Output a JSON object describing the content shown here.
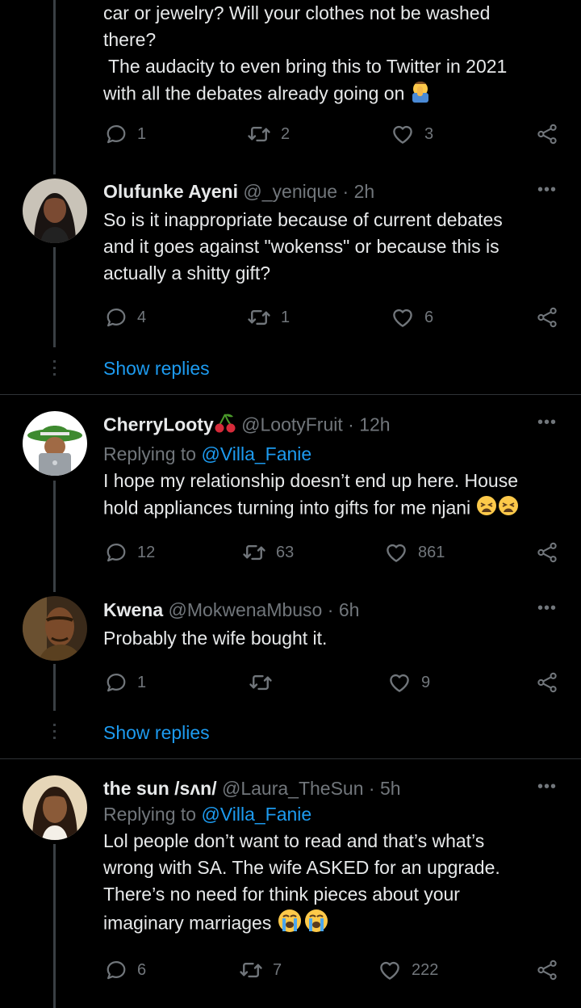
{
  "colors": {
    "background": "#000000",
    "link": "#1d9bf0",
    "muted": "#71767b",
    "text": "#e7e9ea"
  },
  "icons": {
    "reply": "speech-bubble-icon",
    "retweet": "retweet-arrows-icon",
    "like": "heart-icon",
    "share": "share-nodes-icon",
    "more": "ellipsis-icon"
  },
  "tweet0": {
    "lines": [
      "car or jewelry? Will your clothes not be washed",
      "there?",
      " The audacity to even bring this to Twitter in 2021",
      "with all the debates already going on"
    ],
    "emoji": "facepalm-emoji",
    "replies": "1",
    "retweets": "2",
    "likes": "3"
  },
  "tweet1": {
    "name": "Olufunke Ayeni",
    "handle": "@_yenique",
    "time": "2h",
    "dot": "·",
    "lines": [
      "So is it inappropriate because of current debates",
      "and it goes against \"wokenss\" or because this is",
      "actually a shitty gift?"
    ],
    "replies": "4",
    "retweets": "1",
    "likes": "6",
    "show_replies": "Show replies"
  },
  "tweet2": {
    "name": "CherryLooty",
    "name_emoji": "cherries-emoji",
    "handle": "@LootyFruit",
    "time": "12h",
    "dot": "·",
    "replying_prefix": "Replying to",
    "replying_handle": "@Villa_Fanie",
    "lines": [
      "I hope my relationship doesn’t end up here. House",
      "hold appliances turning into gifts for me njani"
    ],
    "emoji": "weary-face-emoji",
    "replies": "12",
    "retweets": "63",
    "likes": "861"
  },
  "tweet3": {
    "name": "Kwena",
    "handle": "@MokwenaMbuso",
    "time": "6h",
    "dot": "·",
    "lines": [
      "Probably the wife bought it."
    ],
    "replies": "1",
    "retweets": "",
    "likes": "9",
    "show_replies": "Show replies"
  },
  "tweet4": {
    "name": "the sun /sʌn/",
    "handle": "@Laura_TheSun",
    "time": "5h",
    "dot": "·",
    "replying_prefix": "Replying to",
    "replying_handle": "@Villa_Fanie",
    "lines": [
      "Lol people don’t want to read and that’s what’s",
      "wrong with SA. The wife ASKED for an upgrade.",
      "There’s no need for think pieces about your",
      "imaginary marriages"
    ],
    "emoji": "loudly-crying-face-emoji",
    "replies": "6",
    "retweets": "7",
    "likes": "222"
  }
}
